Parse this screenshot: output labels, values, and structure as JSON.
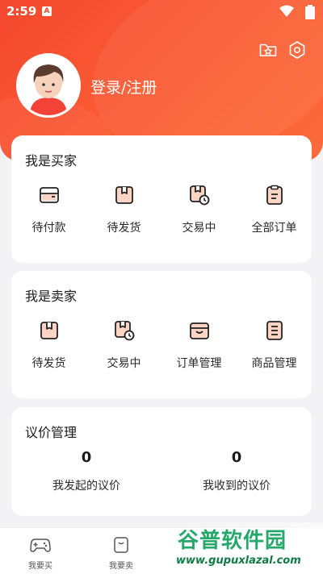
{
  "status_bar": {
    "time": "2:59",
    "notification_letter": "A"
  },
  "profile": {
    "login_label": "登录/注册"
  },
  "header_icons": [
    "favorites-folder-icon",
    "settings-hexagon-icon"
  ],
  "buyer": {
    "title": "我是买家",
    "items": [
      {
        "label": "待付款",
        "icon": "wallet-icon"
      },
      {
        "label": "待发货",
        "icon": "package-icon"
      },
      {
        "label": "交易中",
        "icon": "package-clock-icon"
      },
      {
        "label": "全部订单",
        "icon": "clipboard-icon"
      }
    ]
  },
  "seller": {
    "title": "我是卖家",
    "items": [
      {
        "label": "待发货",
        "icon": "package-icon"
      },
      {
        "label": "交易中",
        "icon": "package-clock-icon"
      },
      {
        "label": "订单管理",
        "icon": "box-icon"
      },
      {
        "label": "商品管理",
        "icon": "list-document-icon"
      }
    ]
  },
  "negotiation": {
    "title": "议价管理",
    "stats": [
      {
        "value": "0",
        "label": "我发起的议价"
      },
      {
        "value": "0",
        "label": "我收到的议价"
      }
    ]
  },
  "tabbar": {
    "tabs": [
      {
        "label": "我要买",
        "icon": "gamepad-icon"
      },
      {
        "label": "我要卖",
        "icon": "bag-icon"
      }
    ]
  },
  "watermark": {
    "title": "谷普软件园",
    "url": "www.gupuxlazal.com"
  },
  "colors": {
    "accent": "#f4482f",
    "icon_gradient": "#fb8a5c"
  }
}
